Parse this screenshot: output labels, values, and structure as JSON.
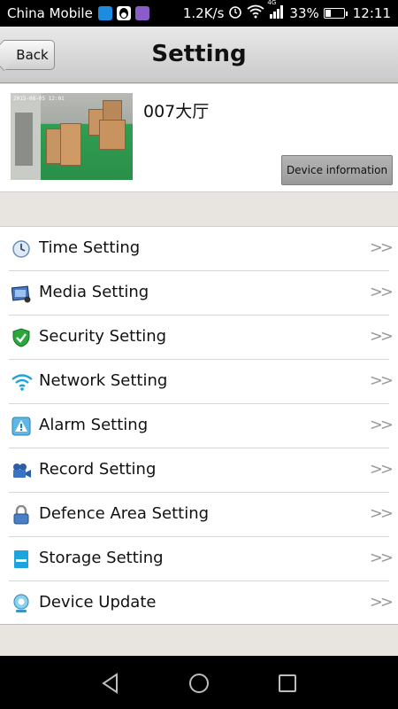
{
  "status_bar": {
    "carrier": "China Mobile",
    "speed": "1.2K/s",
    "network": "4G",
    "battery": "33%",
    "battery_level": 0.33,
    "time": "12:11"
  },
  "header": {
    "back_label": "Back",
    "title": "Setting"
  },
  "device": {
    "name": "007大厅",
    "thumbnail_timestamp": "2015-08-05 12:01",
    "info_button": "Device information"
  },
  "menu": {
    "items": [
      {
        "label": "Time Setting",
        "icon": "clock-icon",
        "arrow": ">>"
      },
      {
        "label": "Media Setting",
        "icon": "media-icon",
        "arrow": ">>"
      },
      {
        "label": "Security Setting",
        "icon": "shield-icon",
        "arrow": ">>"
      },
      {
        "label": "Network Setting",
        "icon": "wifi-icon",
        "arrow": ">>"
      },
      {
        "label": "Alarm Setting",
        "icon": "alarm-icon",
        "arrow": ">>"
      },
      {
        "label": "Record Setting",
        "icon": "camcorder-icon",
        "arrow": ">>"
      },
      {
        "label": "Defence Area Setting",
        "icon": "lock-icon",
        "arrow": ">>"
      },
      {
        "label": "Storage Setting",
        "icon": "storage-icon",
        "arrow": ">>"
      },
      {
        "label": "Device Update",
        "icon": "webcam-icon",
        "arrow": ">>"
      }
    ]
  },
  "colors": {
    "header_top": "#e9e9e9",
    "header_bottom": "#c9c9c9",
    "background": "#e8e5e0",
    "accent_blue": "#1ea4dc",
    "shield_green": "#2aa83c"
  }
}
